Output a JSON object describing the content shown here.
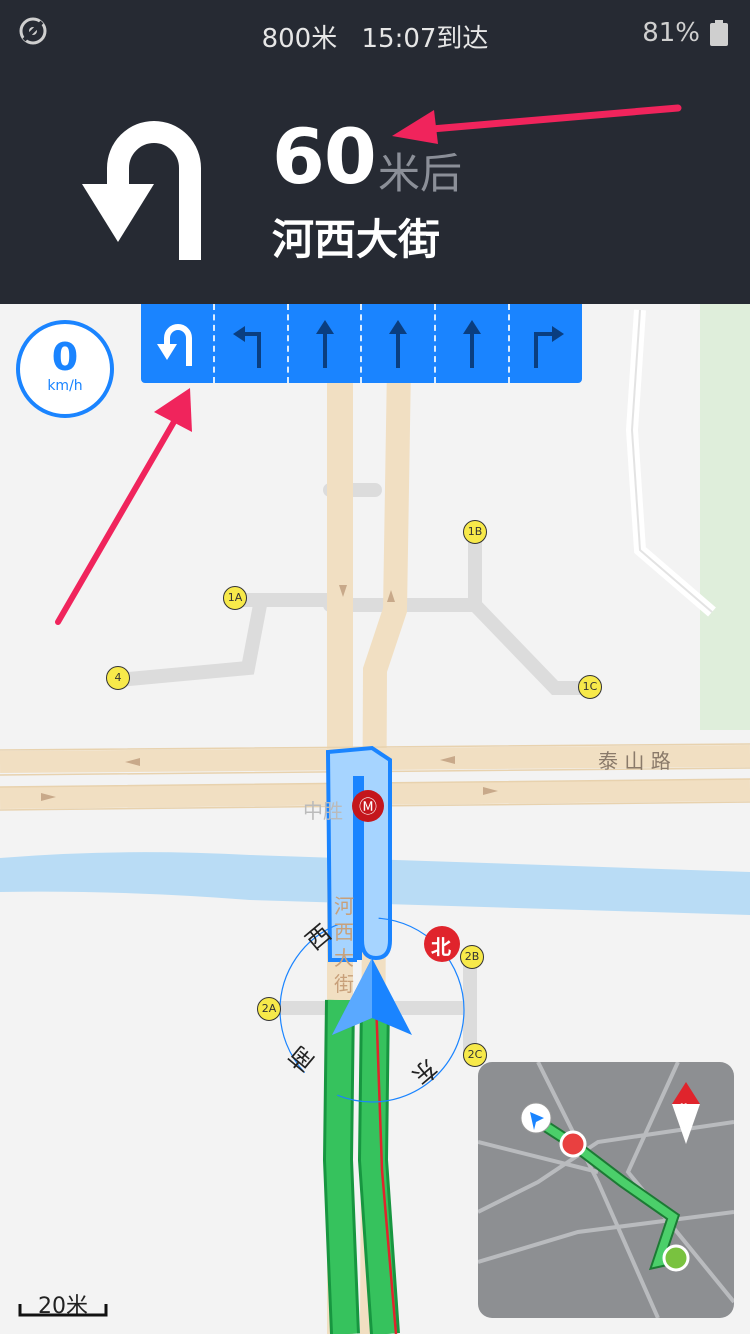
{
  "status_bar": {
    "remaining_distance": "800米",
    "arrival": "15:07到达",
    "battery": "81%"
  },
  "guidance": {
    "distance": "60",
    "unit": "米后",
    "road": "河西大街",
    "maneuver": "u-turn-left-icon"
  },
  "lanes": [
    {
      "icon": "u-turn-lane-icon",
      "active": true
    },
    {
      "icon": "turn-left-lane-icon",
      "active": false
    },
    {
      "icon": "straight-lane-icon",
      "active": false
    },
    {
      "icon": "straight-lane-icon",
      "active": false
    },
    {
      "icon": "straight-lane-icon",
      "active": false
    },
    {
      "icon": "turn-right-lane-icon",
      "active": false
    }
  ],
  "speed": {
    "value": "0",
    "unit": "km/h"
  },
  "map": {
    "road_taishan": "泰 山 路",
    "road_hexi": [
      "河",
      "西",
      "大",
      "街"
    ],
    "station": "中胜",
    "compass": {
      "north": "北",
      "west": "西",
      "south": "南",
      "east": "东"
    },
    "exits": [
      "1A",
      "1B",
      "1C",
      "4",
      "2A",
      "2B",
      "2C"
    ]
  },
  "scale": {
    "label": "20米"
  },
  "minimap": {
    "north": "北"
  },
  "colors": {
    "route": "#22b04b",
    "accent": "#1a84ff",
    "panel": "#262a33",
    "annotation": "#f0245c"
  }
}
